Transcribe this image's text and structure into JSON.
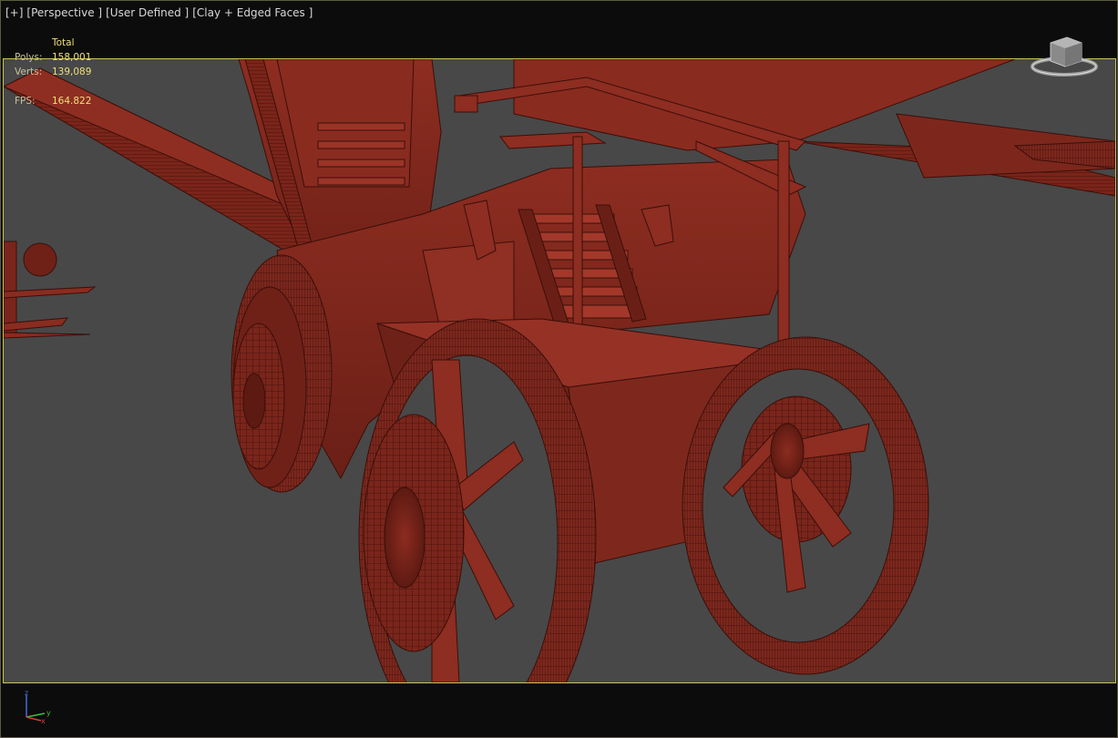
{
  "viewport": {
    "menu_plus": "[+]",
    "view_mode": "[Perspective ]",
    "view_user": "[User Defined ]",
    "shading": "[Clay + Edged Faces ]"
  },
  "stats": {
    "header": "Total",
    "rows": [
      {
        "label": "Polys:",
        "value": "158,001"
      },
      {
        "label": "Verts:",
        "value": "139,089"
      },
      {
        "label": "FPS:",
        "value": "164.822"
      }
    ]
  },
  "viewcube_icon": "viewcube-icon",
  "axis": {
    "z": "z",
    "x": "x",
    "y": "y"
  },
  "colors": {
    "model_base": "#7a251b",
    "model_light": "#a8382a",
    "model_dark": "#4c130c",
    "background": "#484848",
    "border_highlight": "#c9c45a",
    "stats_text": "#f1df7a"
  }
}
